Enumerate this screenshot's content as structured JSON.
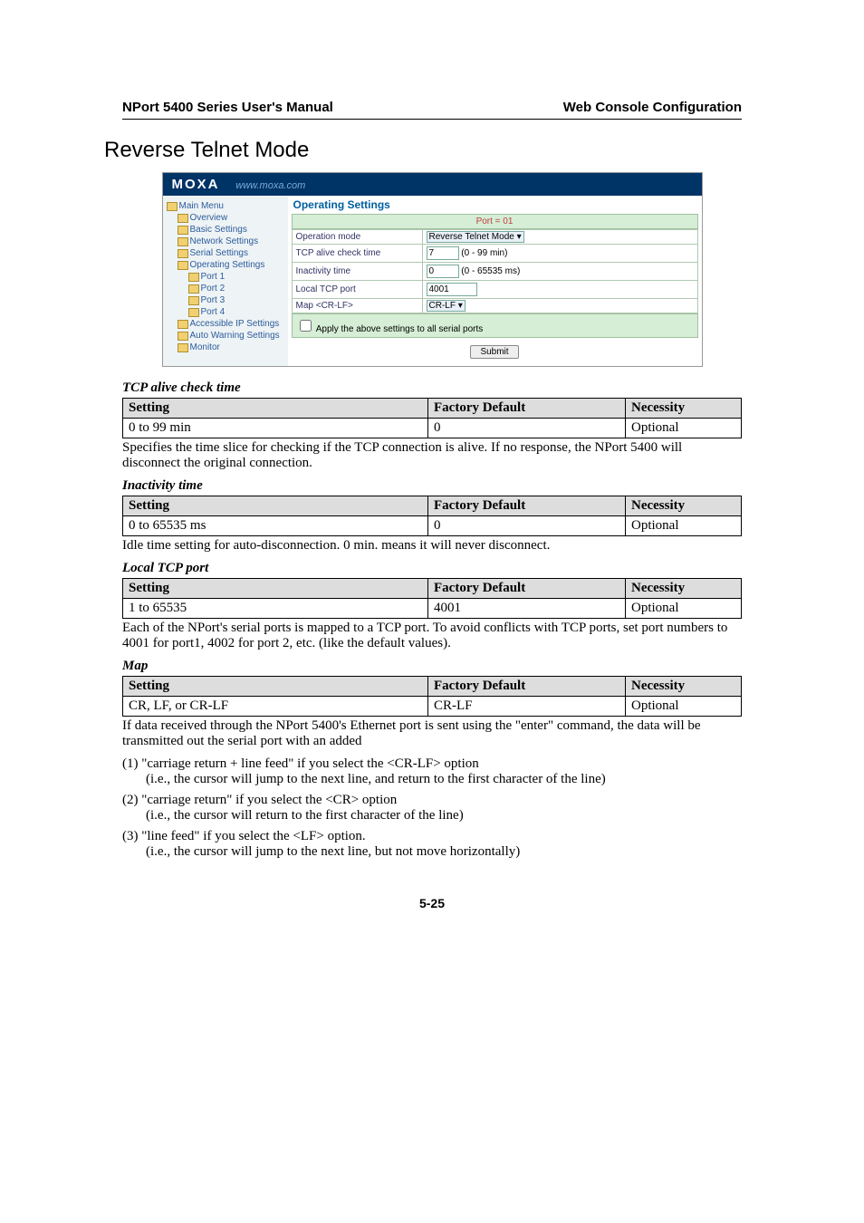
{
  "header": {
    "left": "NPort 5400 Series User's Manual",
    "right": "Web Console Configuration"
  },
  "section_title": "Reverse Telnet Mode",
  "screenshot": {
    "brand": "MOXA",
    "url": "www.moxa.com",
    "nav": {
      "main": "Main Menu",
      "items": [
        "Overview",
        "Basic Settings",
        "Network Settings",
        "Serial Settings",
        "Operating Settings"
      ],
      "ports": [
        "Port 1",
        "Port 2",
        "Port 3",
        "Port 4"
      ],
      "tail": [
        "Accessible IP Settings",
        "Auto Warning Settings",
        "Monitor"
      ]
    },
    "main_title": "Operating Settings",
    "port_label": "Port = 01",
    "rows": {
      "op_mode": {
        "label": "Operation mode",
        "value": "Reverse Telnet Mode"
      },
      "tcp_alive": {
        "label": "TCP alive check time",
        "value": "7",
        "suffix": "(0 - 99 min)"
      },
      "inactivity": {
        "label": "Inactivity time",
        "value": "0",
        "suffix": "(0 - 65535 ms)"
      },
      "local_tcp": {
        "label": "Local TCP port",
        "value": "4001"
      },
      "map": {
        "label": "Map <CR-LF>",
        "value": "CR-LF"
      }
    },
    "apply_label": "Apply the above settings to all serial ports",
    "submit": "Submit"
  },
  "params": [
    {
      "title": "TCP alive check time",
      "setting": "0 to 99 min",
      "default": "0",
      "necessity": "Optional",
      "desc": "Specifies the time slice for checking if the TCP connection is alive. If no response, the NPort 5400 will disconnect the original connection."
    },
    {
      "title": "Inactivity time",
      "setting": "0 to 65535 ms",
      "default": "0",
      "necessity": "Optional",
      "desc": "Idle time setting for auto-disconnection. 0 min. means it will never disconnect."
    },
    {
      "title": "Local TCP port",
      "setting": "1 to 65535",
      "default": "4001",
      "necessity": "Optional",
      "desc": "Each of the NPort's serial ports is mapped to a TCP port. To avoid conflicts with TCP ports, set port numbers to 4001 for port1, 4002 for port 2, etc. (like the default values)."
    },
    {
      "title": "Map <CR-LF>",
      "setting": "CR, LF, or CR-LF",
      "default": "CR-LF",
      "necessity": "Optional",
      "desc": "If data received through the NPort 5400's Ethernet port is sent using the \"enter\" command, the data will be transmitted out the serial port with an added"
    }
  ],
  "table_headers": {
    "c1": "Setting",
    "c2": "Factory Default",
    "c3": "Necessity"
  },
  "enumerated": [
    {
      "num": "(1)",
      "main": "\"carriage return + line feed\" if you select the <CR-LF> option",
      "sub": "(i.e., the cursor will jump to the next line, and return to the first character of the line)"
    },
    {
      "num": "(2)",
      "main": "\"carriage return\" if you select the <CR> option",
      "sub": "(i.e., the cursor will return to the first character of the line)"
    },
    {
      "num": "(3)",
      "main": "\"line feed\" if you select the <LF> option.",
      "sub": "(i.e., the cursor will jump to the next line, but not move horizontally)"
    }
  ],
  "page_number": "5-25"
}
